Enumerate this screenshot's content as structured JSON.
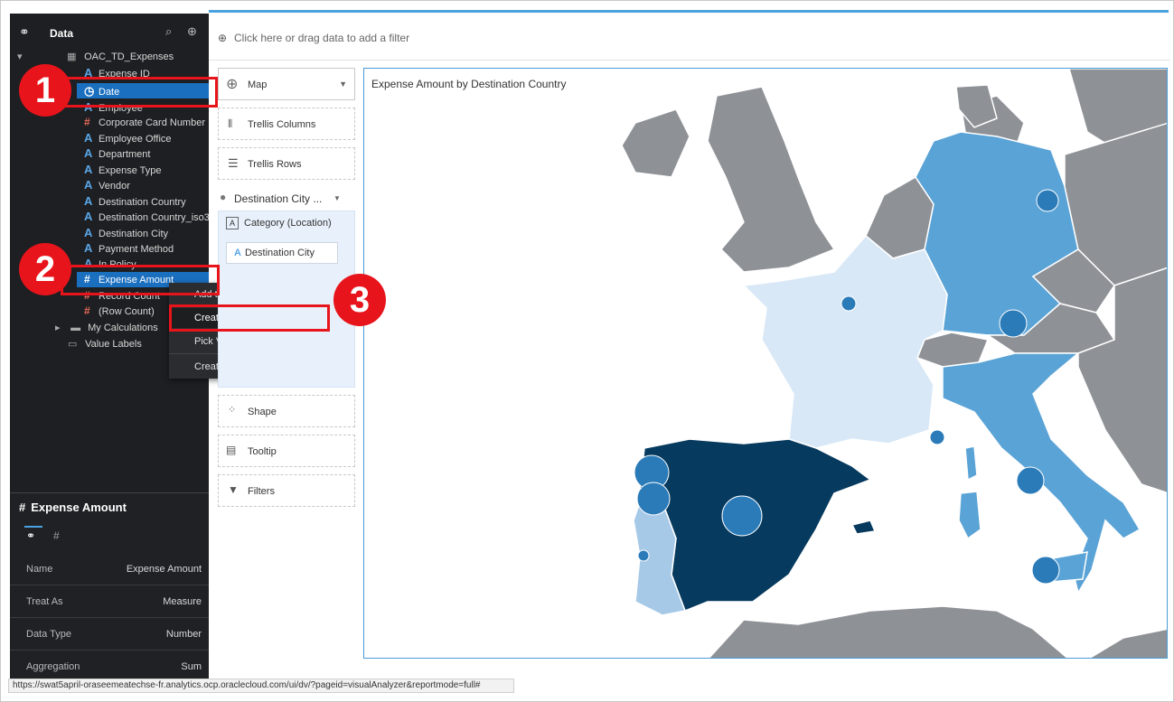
{
  "colors": {
    "accent": "#1a6fbf",
    "annotation": "#e8141b",
    "sidebar_bg": "#1e1f22",
    "dark_blue": "#063a5e",
    "mid_blue": "#5aa3d6",
    "light_blue": "#d8e8f6",
    "land_gray": "#8e9196"
  },
  "sidebar": {
    "title": "Data",
    "icons": [
      "dataset-icon",
      "search-icon",
      "add-icon"
    ],
    "dataset": "OAC_TD_Expenses",
    "fields": [
      {
        "label": "Expense ID",
        "type": "attribute"
      },
      {
        "label": "Date",
        "type": "date",
        "selected": true
      },
      {
        "label": "Employee",
        "type": "attribute"
      },
      {
        "label": "Corporate Card Number",
        "type": "measure"
      },
      {
        "label": "Employee Office",
        "type": "attribute"
      },
      {
        "label": "Department",
        "type": "attribute"
      },
      {
        "label": "Expense Type",
        "type": "attribute"
      },
      {
        "label": "Vendor",
        "type": "attribute"
      },
      {
        "label": "Destination Country",
        "type": "attribute"
      },
      {
        "label": "Destination Country_iso3",
        "type": "attribute"
      },
      {
        "label": "Destination City",
        "type": "attribute"
      },
      {
        "label": "Payment Method",
        "type": "attribute"
      },
      {
        "label": "In Policy",
        "type": "attribute"
      },
      {
        "label": "Expense Amount",
        "type": "measure",
        "selected": true
      },
      {
        "label": "Record Count",
        "type": "measure"
      },
      {
        "label": "(Row Count)",
        "type": "measure"
      }
    ],
    "folders": [
      {
        "label": "My Calculations"
      },
      {
        "label": "Value Labels"
      }
    ]
  },
  "context_menu": {
    "items": [
      "Add to Selected Visualization",
      "Create Best Visualization",
      "Pick Visualization...",
      "Create Filters"
    ],
    "highlighted": "Create Best Visualization"
  },
  "properties": {
    "title": "Expense Amount",
    "rows": [
      {
        "key": "Name",
        "value": "Expense Amount"
      },
      {
        "key": "Treat As",
        "value": "Measure"
      },
      {
        "key": "Data Type",
        "value": "Number"
      },
      {
        "key": "Aggregation",
        "value": "Sum"
      }
    ]
  },
  "filter_bar": {
    "text": "Click here or drag data to add a filter"
  },
  "grammar": {
    "viz_type": "Map",
    "trellis_columns": "Trellis Columns",
    "trellis_rows": "Trellis Rows",
    "destination": "Destination City ...",
    "category": "Category (Location)",
    "destination_city": "Destination City",
    "shape": "Shape",
    "tooltip": "Tooltip",
    "filters": "Filters"
  },
  "viz": {
    "title": "Expense Amount by Destination Country"
  },
  "annotations": {
    "step1": "1",
    "step2": "2",
    "step3": "3"
  },
  "status_url": "https://swat5april-oraseemeatechse-fr.analytics.ocp.oraclecloud.com/ui/dv/?pageid=visualAnalyzer&reportmode=full#"
}
